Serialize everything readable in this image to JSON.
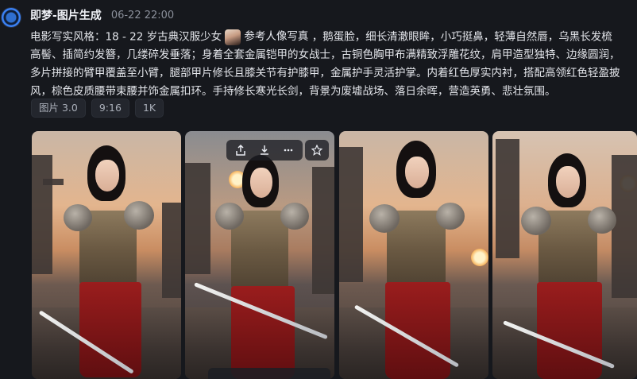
{
  "header": {
    "app_name": "即梦-图片生成",
    "timestamp": "06-22  22:00"
  },
  "prompt": {
    "line1_before": "电影写实风格：18 - 22 岁古典汉服少女",
    "reference_label": "参考人像写真",
    "line1_after": "，鹅蛋脸，细长清澈眼眸，小巧挺鼻，轻薄自然唇，乌黑长发梳",
    "line2": "高髻、插简约发簪，几缕碎发垂落；身着全套金属铠甲的女战士，古铜色胸甲布满精致浮雕花纹，肩甲造型独特、边缘圆润，",
    "line3": "多片拼接的臂甲覆盖至小臂，腿部甲片修长且膝关节有护膝甲，金属护手灵活护掌。内着红色厚实内衬，搭配高领红色轻盈披",
    "line4": "风，棕色皮质腰带束腰并饰金属扣环。手持修长寒光长剑，背景为废墟战场、落日余晖，营造英勇、悲壮氛围。"
  },
  "tags": [
    "图片 3.0",
    "9:16",
    "1K"
  ],
  "images": [
    {
      "label": "generated-image-1"
    },
    {
      "label": "generated-image-2"
    },
    {
      "label": "generated-image-3"
    },
    {
      "label": "generated-image-4"
    }
  ],
  "icons": {
    "share": "share-icon",
    "download": "download-icon",
    "more": "more-icon",
    "favorite": "star-icon"
  },
  "colors": {
    "background": "#16181d",
    "tag_background": "#23262d",
    "accent_blue": "#3b82f6"
  }
}
